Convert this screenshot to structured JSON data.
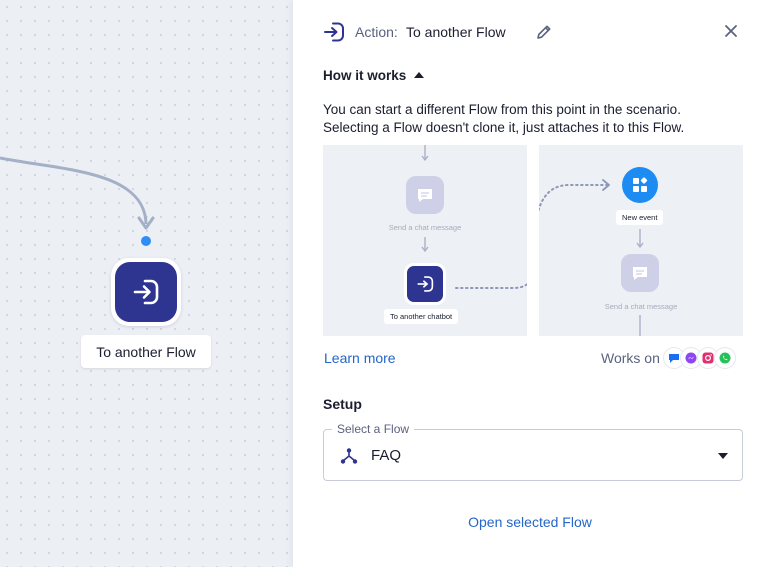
{
  "canvas": {
    "node_label": "To another Flow"
  },
  "panel": {
    "header": {
      "action_prefix": "Action:",
      "action_title": "To another Flow"
    },
    "how_it_works": {
      "toggle_label": "How it works",
      "description_line1": "You can start a different Flow from this point in the scenario.",
      "description_line2": "Selecting a Flow doesn't clone it, just attaches it to this Flow.",
      "illustration_left": {
        "send_label": "Send a chat message",
        "node_label": "To another chatbot"
      },
      "illustration_right": {
        "event_label": "New event",
        "send_label": "Send a chat message"
      }
    },
    "learn_more": "Learn more",
    "works_on": "Works on",
    "channels": [
      "livechat-icon",
      "messenger-icon",
      "instagram-icon",
      "whatsapp-icon"
    ],
    "setup": {
      "title": "Setup",
      "select_label": "Select a Flow",
      "select_value": "FAQ"
    },
    "open_flow_link": "Open selected Flow"
  },
  "colors": {
    "accent_dark": "#2d3591",
    "accent_blue": "#1d8cf2",
    "link": "#2466c9",
    "connector": "#2f8df6"
  }
}
